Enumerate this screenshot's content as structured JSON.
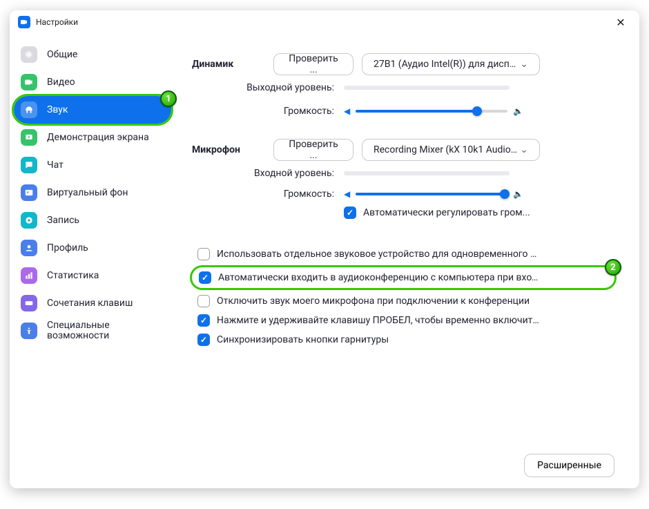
{
  "window": {
    "title": "Настройки"
  },
  "sidebar": {
    "items": [
      {
        "label": "Общие",
        "icon": "gear",
        "color": "#d9d9df"
      },
      {
        "label": "Видео",
        "icon": "video",
        "color": "#36c36a"
      },
      {
        "label": "Звук",
        "icon": "head",
        "color": "#0e71eb",
        "active": true,
        "highlight": true,
        "badge": "1"
      },
      {
        "label": "Демонстрация экрана",
        "icon": "share",
        "color": "#36c36a"
      },
      {
        "label": "Чат",
        "icon": "chat",
        "color": "#12b7c9"
      },
      {
        "label": "Виртуальный фон",
        "icon": "bg",
        "color": "#4a7eea"
      },
      {
        "label": "Запись",
        "icon": "record",
        "color": "#12b7c9"
      },
      {
        "label": "Профиль",
        "icon": "profile",
        "color": "#4a7eea"
      },
      {
        "label": "Статистика",
        "icon": "stats",
        "color": "#aa6aea"
      },
      {
        "label": "Сочетания клавиш",
        "icon": "keyboard",
        "color": "#8468e8"
      },
      {
        "label": "Специальные возможности",
        "icon": "access",
        "color": "#4a7eea",
        "multiline": true
      }
    ]
  },
  "speaker": {
    "heading": "Динамик",
    "test_label": "Проверить ...",
    "device": "27B1 (Аудио Intel(R)) для дисплее...",
    "output_level_label": "Выходной уровень:",
    "volume_label": "Громкость:",
    "volume_pct": 80
  },
  "microphone": {
    "heading": "Микрофон",
    "test_label": "Проверить ...",
    "device": "Recording Mixer (kX 10k1 Audio ...",
    "input_level_label": "Входной уровень:",
    "volume_label": "Громкость:",
    "volume_pct": 98,
    "auto_adjust": {
      "checked": true,
      "label": "Автоматически регулировать гром..."
    }
  },
  "options": [
    {
      "checked": false,
      "label": "Использовать отдельное звуковое устройство для одновременного воспро..."
    },
    {
      "checked": true,
      "label": "Автоматически входить в аудиоконференцию с компьютера при входе в кон...",
      "highlight": true,
      "badge": "2"
    },
    {
      "checked": false,
      "label": "Отключить звук моего микрофона при подключении к конференции"
    },
    {
      "checked": true,
      "label": "Нажмите и удерживайте клавишу ПРОБЕЛ, чтобы временно включить свой з..."
    },
    {
      "checked": true,
      "label": "Синхронизировать кнопки гарнитуры"
    }
  ],
  "advanced_label": "Расширенные"
}
